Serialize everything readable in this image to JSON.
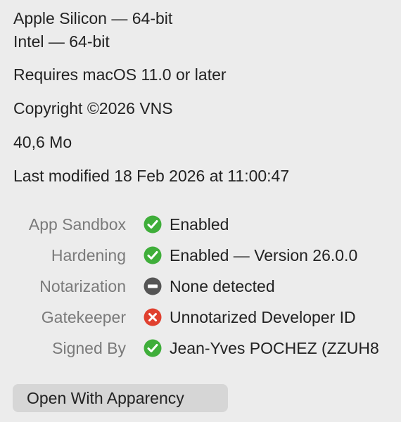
{
  "info": {
    "arch_apple": "Apple Silicon — 64-bit",
    "arch_intel": "Intel — 64-bit",
    "requirement": "Requires macOS 11.0 or later",
    "copyright": "Copyright ©2026 VNS",
    "size": "40,6 Mo",
    "modified": "Last modified 18 Feb 2026 at 11:00:47"
  },
  "security": {
    "rows": [
      {
        "label": "App Sandbox",
        "status": "ok",
        "icon": "check-circle-icon",
        "value": "Enabled"
      },
      {
        "label": "Hardening",
        "status": "ok",
        "icon": "check-circle-icon",
        "value": "Enabled — Version 26.0.0"
      },
      {
        "label": "Notarization",
        "status": "none",
        "icon": "minus-circle-icon",
        "value": "None detected"
      },
      {
        "label": "Gatekeeper",
        "status": "error",
        "icon": "x-circle-icon",
        "value": "Unnotarized Developer ID"
      },
      {
        "label": "Signed By",
        "status": "ok",
        "icon": "check-circle-icon",
        "value": "Jean-Yves POCHEZ (ZZUH8"
      }
    ]
  },
  "actions": {
    "open_with_label": "Open With Apparency"
  },
  "colors": {
    "ok": "#3fae3a",
    "error": "#e0402f",
    "none": "#555555",
    "label_gray": "#7a7a7a"
  }
}
